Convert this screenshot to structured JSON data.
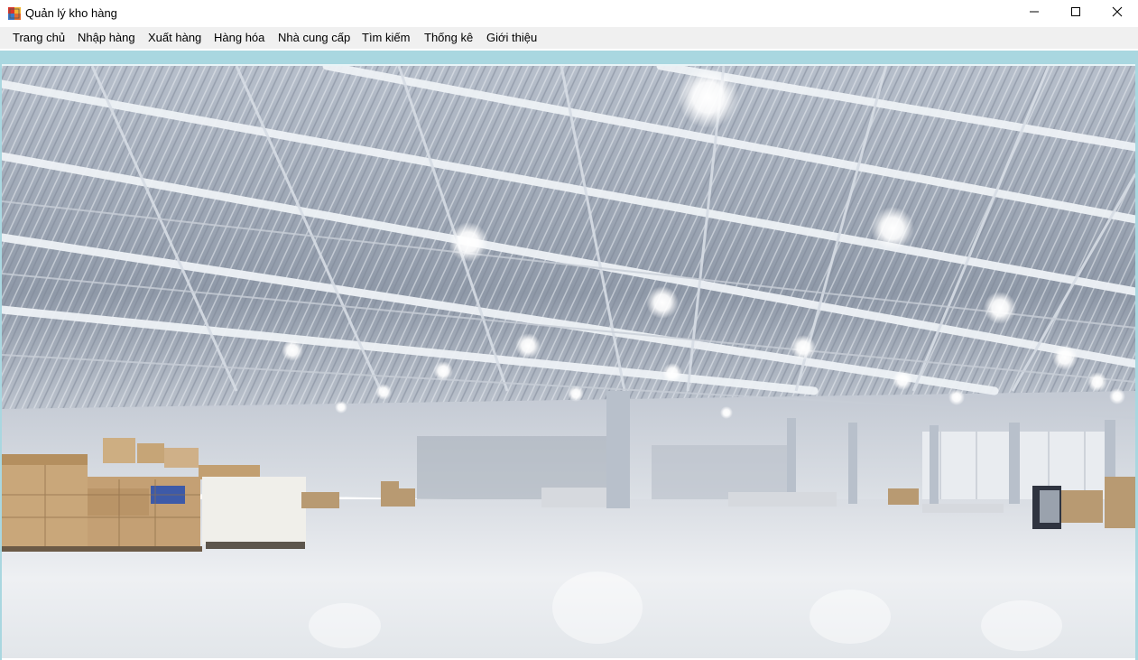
{
  "window": {
    "title": "Quản lý kho hàng",
    "icon": "app-window-icon",
    "controls": {
      "minimize": "minimize-icon",
      "maximize": "maximize-icon",
      "close": "close-icon"
    }
  },
  "menu": {
    "items": [
      {
        "label": "Trang chủ"
      },
      {
        "label": "Nhập hàng"
      },
      {
        "label": "Xuất hàng"
      },
      {
        "label": "Hàng hóa"
      },
      {
        "label": "Nhà cung cấp"
      },
      {
        "label": "Tìm kiếm"
      },
      {
        "label": "Thống kê"
      },
      {
        "label": "Giới thiệu"
      }
    ]
  },
  "background_image": "warehouse-interior-photo",
  "colors": {
    "menubar_bg": "#f0f0f0",
    "band": "#a9d7e0"
  }
}
